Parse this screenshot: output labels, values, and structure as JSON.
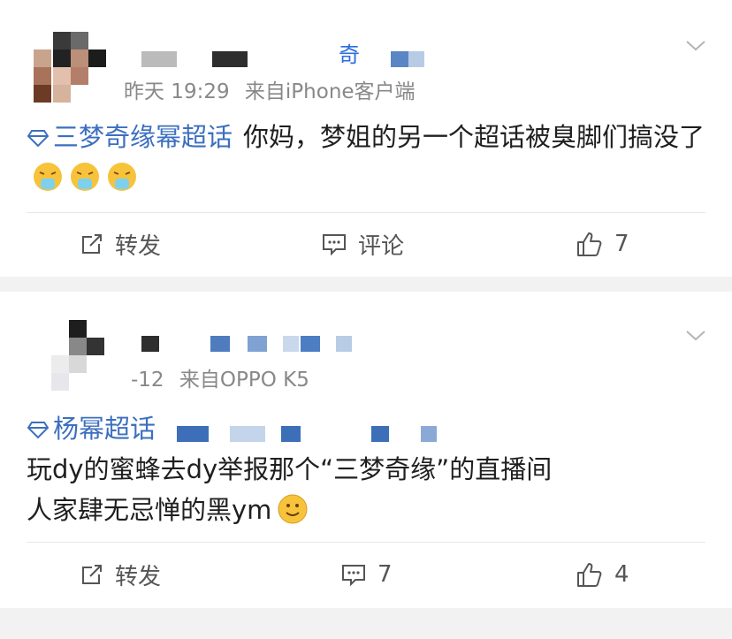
{
  "posts": [
    {
      "username_fragment": "奇",
      "time": "昨天 19:29",
      "source": "来自iPhone客户端",
      "topic": "三梦奇缘幂超话",
      "text": "你妈，梦姐的另一个超话被臭脚们搞没了",
      "emoji_count": 3,
      "actions": {
        "repost": "转发",
        "comment": "评论",
        "like": "7"
      }
    },
    {
      "time": "-12",
      "source": "来自OPPO K5",
      "topic": "杨幂超话",
      "text_line1": "玩dy的蜜蜂去dy举报那个“三梦奇缘”的直播间",
      "text_line2": "人家肆无忌惮的黑ym",
      "actions": {
        "repost": "转发",
        "comment": "7",
        "like": "4"
      }
    }
  ],
  "colors": {
    "accent": "#3c6fbf",
    "meta": "#888888",
    "background": "#f2f2f2"
  },
  "icons": [
    "chevron-down-icon",
    "diamond-icon",
    "repost-icon",
    "comment-icon",
    "like-icon",
    "vomit-emoji",
    "smile-emoji"
  ]
}
